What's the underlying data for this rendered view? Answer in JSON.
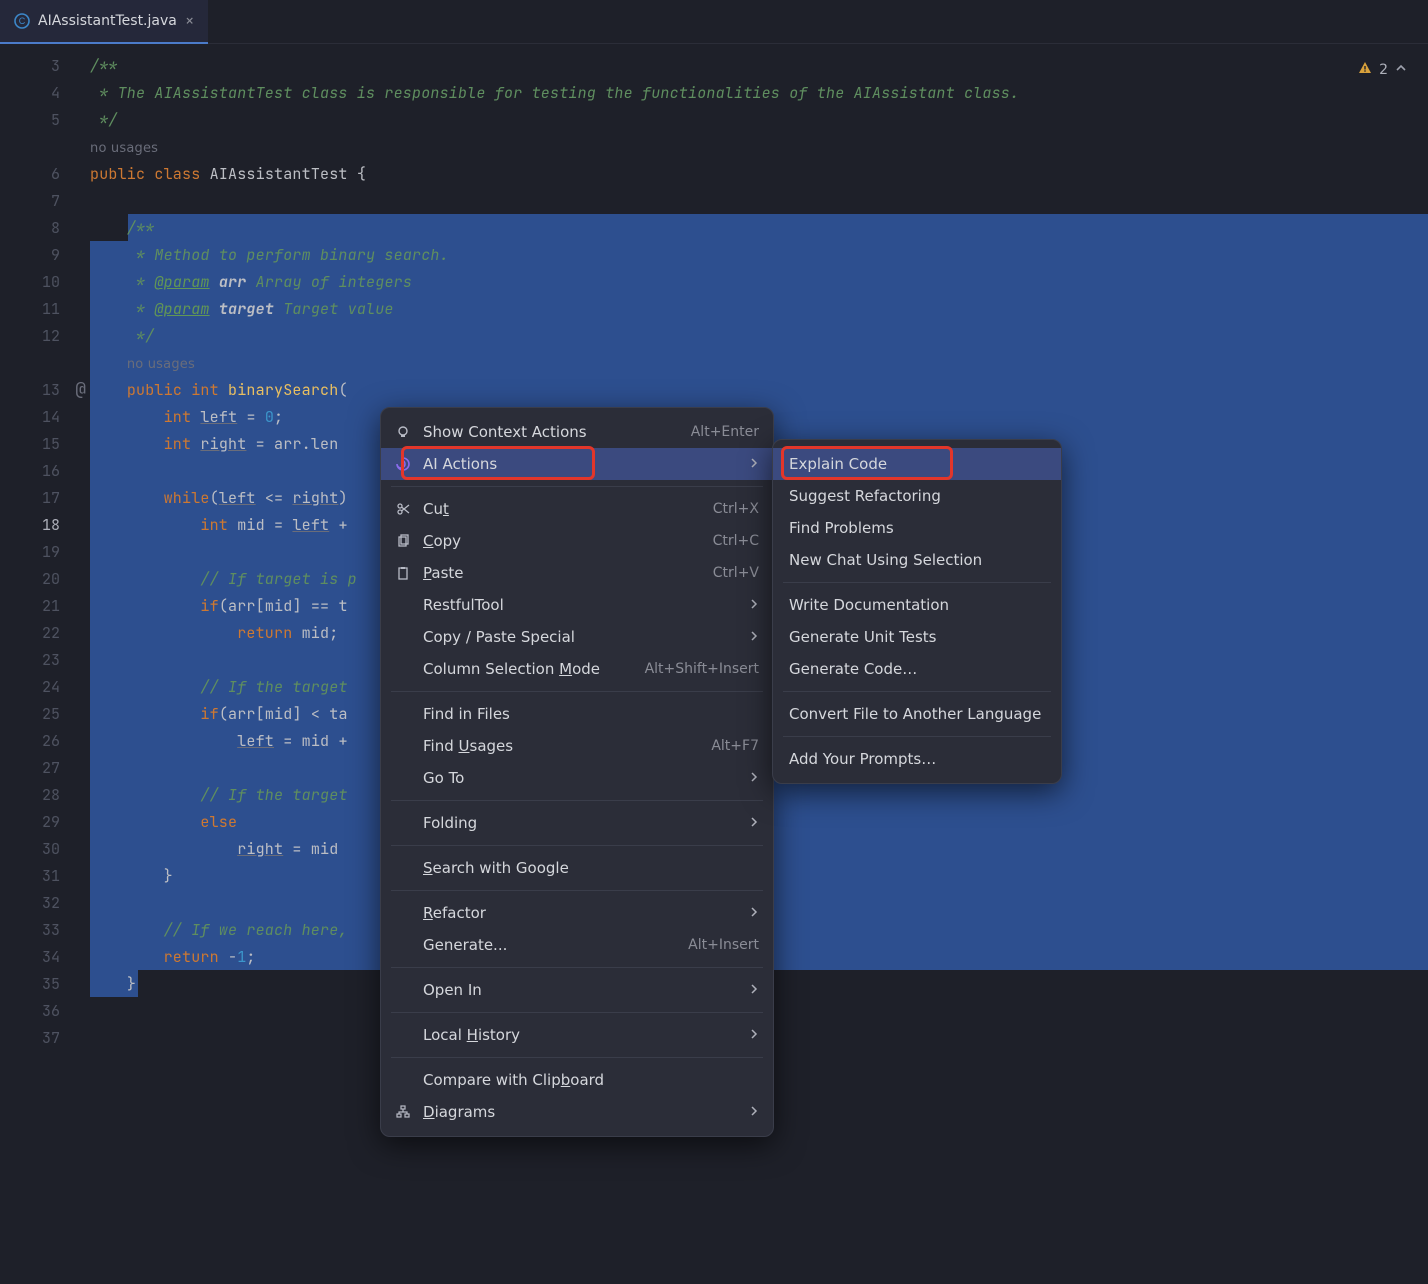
{
  "tab": {
    "title": "AIAssistantTest.java"
  },
  "warnings": {
    "count": "2"
  },
  "usages_label": "no usages",
  "gutter": {
    "start": 3,
    "end": 37,
    "current": 18,
    "override_at": 13
  },
  "code": {
    "lines": [
      {
        "n": 3,
        "html": "<span class='c-javadoc'>/**</span>"
      },
      {
        "n": 4,
        "html": "<span class='c-javadoc'> * The AIAssistantTest class is responsible for testing the functionalities of the AIAssistant class.</span>"
      },
      {
        "n": 5,
        "html": "<span class='c-javadoc'> */</span>"
      },
      {
        "n": -1,
        "html": "<span class='usages'>no usages</span>"
      },
      {
        "n": 6,
        "html": "<span class='c-keyword'>public</span> <span class='c-keyword'>class</span> <span class='c-class'>AIAssistantTest</span> <span class='c-punc'>{</span>",
        "normal": true
      },
      {
        "n": 7,
        "html": ""
      },
      {
        "n": 8,
        "html": "    <span class='c-javadoc'>/**</span>",
        "sel_from": 4
      },
      {
        "n": 9,
        "html": "    <span class='c-javadoc'> * Method to perform binary search.</span>",
        "sel": true
      },
      {
        "n": 10,
        "html": "    <span class='c-javadoc'> * <span class='c-tag'>@param</span> <span class='c-tagname'>arr</span> Array of integers</span>",
        "sel": true
      },
      {
        "n": 11,
        "html": "    <span class='c-javadoc'> * <span class='c-tag'>@param</span> <span class='c-tagname'>target</span> Target value</span>",
        "sel": true
      },
      {
        "n": 12,
        "html": "    <span class='c-javadoc'> */</span>",
        "sel": true
      },
      {
        "n": -1,
        "html": "    <span class='usages'>no usages</span>",
        "sel": true
      },
      {
        "n": 13,
        "html": "    <span class='c-keyword'>public</span> <span class='c-keyword'>int</span> <span class='c-method'>binarySearch</span><span class='c-punc'>(</span>",
        "sel": true,
        "normal": true
      },
      {
        "n": 14,
        "html": "        <span class='c-keyword'>int</span> <span class='c-param'>left</span> <span class='c-punc'>=</span> <span class='c-number'>0</span><span class='c-punc'>;</span>",
        "sel": true,
        "normal": true
      },
      {
        "n": 15,
        "html": "        <span class='c-keyword'>int</span> <span class='c-param'>right</span> <span class='c-punc'>=</span> arr.len",
        "sel": true,
        "normal": true
      },
      {
        "n": 16,
        "html": "",
        "sel": true
      },
      {
        "n": 17,
        "html": "        <span class='c-keyword'>while</span><span class='c-punc'>(</span><span class='c-param'>left</span> <span class='c-punc'>&lt;=</span> <span class='c-param'>right</span><span class='c-punc'>)</span>",
        "sel": true,
        "normal": true
      },
      {
        "n": 18,
        "html": "            <span class='c-keyword'>int</span> mid <span class='c-punc'>=</span> <span class='c-param'>left</span> <span class='c-punc'>+</span>",
        "sel": true,
        "normal": true,
        "current": true
      },
      {
        "n": 19,
        "html": "",
        "sel": true
      },
      {
        "n": 20,
        "html": "            <span class='c-comment'>// If target is p</span>",
        "sel": true
      },
      {
        "n": 21,
        "html": "            <span class='c-keyword'>if</span><span class='c-punc'>(</span>arr<span class='c-punc'>[</span>mid<span class='c-punc'>]</span> <span class='c-punc'>==</span> t",
        "sel": true,
        "normal": true
      },
      {
        "n": 22,
        "html": "                <span class='c-keyword'>return</span> mid<span class='c-punc'>;</span>",
        "sel": true,
        "normal": true
      },
      {
        "n": 23,
        "html": "",
        "sel": true
      },
      {
        "n": 24,
        "html": "            <span class='c-comment'>// If the target</span>",
        "sel": true
      },
      {
        "n": 25,
        "html": "            <span class='c-keyword'>if</span><span class='c-punc'>(</span>arr<span class='c-punc'>[</span>mid<span class='c-punc'>]</span> <span class='c-punc'>&lt;</span> ta",
        "sel": true,
        "normal": true
      },
      {
        "n": 26,
        "html": "                <span class='c-param'>left</span> <span class='c-punc'>=</span> mid <span class='c-punc'>+</span>",
        "sel": true,
        "normal": true
      },
      {
        "n": 27,
        "html": "",
        "sel": true
      },
      {
        "n": 28,
        "html": "            <span class='c-comment'>// If the target</span>",
        "sel": true
      },
      {
        "n": 29,
        "html": "            <span class='c-keyword'>else</span>",
        "sel": true,
        "normal": true
      },
      {
        "n": 30,
        "html": "                <span class='c-param'>right</span> <span class='c-punc'>=</span> mid",
        "sel": true,
        "normal": true
      },
      {
        "n": 31,
        "html": "        <span class='c-punc'>}</span>",
        "sel": true,
        "normal": true
      },
      {
        "n": 32,
        "html": "",
        "sel": true
      },
      {
        "n": 33,
        "html": "        <span class='c-comment'>// If we reach here,</span>",
        "sel": true
      },
      {
        "n": 34,
        "html": "        <span class='c-keyword'>return</span> <span class='c-punc'>-</span><span class='c-number'>1</span><span class='c-punc'>;</span>",
        "sel": true,
        "normal": true
      },
      {
        "n": 35,
        "html": "    <span class='c-punc'>}</span>",
        "sel_to": 5,
        "normal": true
      },
      {
        "n": 36,
        "html": ""
      },
      {
        "n": 37,
        "html": ""
      }
    ]
  },
  "context_menu": {
    "items": [
      {
        "icon": "bulb",
        "label": "Show Context Actions",
        "shortcut": "Alt+Enter"
      },
      {
        "icon": "spiral",
        "label": "AI Actions",
        "submenu": true,
        "highlight": true,
        "red": true
      },
      {
        "sep": true
      },
      {
        "icon": "scissors",
        "label": "Cut",
        "ul": 2,
        "shortcut": "Ctrl+X"
      },
      {
        "icon": "copy",
        "label": "Copy",
        "ul": 0,
        "shortcut": "Ctrl+C"
      },
      {
        "icon": "paste",
        "label": "Paste",
        "ul": 0,
        "shortcut": "Ctrl+V"
      },
      {
        "label": "RestfulTool",
        "submenu": true
      },
      {
        "label": "Copy / Paste Special",
        "submenu": true
      },
      {
        "label": "Column Selection Mode",
        "ul": 17,
        "shortcut": "Alt+Shift+Insert"
      },
      {
        "sep": true
      },
      {
        "label": "Find in Files"
      },
      {
        "label": "Find Usages",
        "ul": 5,
        "shortcut": "Alt+F7"
      },
      {
        "label": "Go To",
        "submenu": true
      },
      {
        "sep": true
      },
      {
        "label": "Folding",
        "submenu": true
      },
      {
        "sep": true
      },
      {
        "label": "Search with Google",
        "ul": 0
      },
      {
        "sep": true
      },
      {
        "label": "Refactor",
        "ul": 0,
        "submenu": true
      },
      {
        "label": "Generate...",
        "shortcut": "Alt+Insert"
      },
      {
        "sep": true
      },
      {
        "label": "Open In",
        "submenu": true
      },
      {
        "sep": true
      },
      {
        "label": "Local History",
        "ul": 6,
        "submenu": true
      },
      {
        "sep": true
      },
      {
        "label": "Compare with Clipboard",
        "ul": 17
      },
      {
        "icon": "diagram",
        "label": "Diagrams",
        "ul": 0,
        "submenu": true
      }
    ]
  },
  "submenu": {
    "items": [
      {
        "label": "Explain Code",
        "highlight": true,
        "red": true
      },
      {
        "label": "Suggest Refactoring"
      },
      {
        "label": "Find Problems"
      },
      {
        "label": "New Chat Using Selection"
      },
      {
        "sep": true
      },
      {
        "label": "Write Documentation"
      },
      {
        "label": "Generate Unit Tests"
      },
      {
        "label": "Generate Code…"
      },
      {
        "sep": true
      },
      {
        "label": "Convert File to Another Language"
      },
      {
        "sep": true
      },
      {
        "label": "Add Your Prompts…"
      }
    ]
  }
}
